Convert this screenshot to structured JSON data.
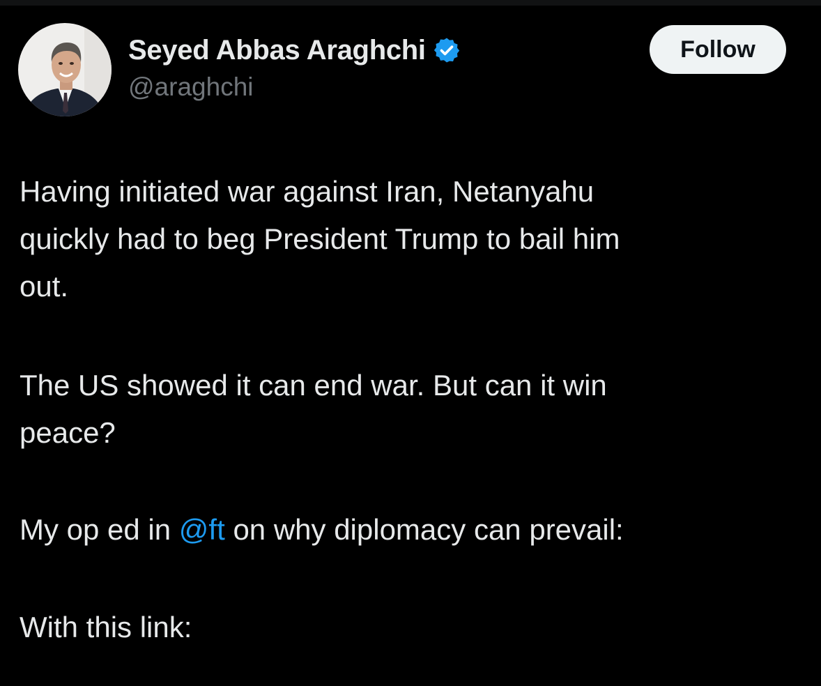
{
  "author": {
    "display_name": "Seyed Abbas Araghchi",
    "handle": "@araghchi",
    "verified_icon": "verified-badge-icon",
    "avatar_icon": "avatar-photo"
  },
  "follow_button": {
    "label": "Follow"
  },
  "tweet": {
    "paragraph1": {
      "line1": "Having initiated war against Iran, Netanyahu",
      "line2": "quickly had to beg President Trump to bail him",
      "line3": "out."
    },
    "paragraph2": {
      "line1": "The US showed it can end war. But can it win",
      "line2": "peace?"
    },
    "paragraph3": {
      "before": "My op ed in ",
      "mention": "@ft",
      "after": " on why diplomacy can prevail:"
    },
    "paragraph4": {
      "line1": "With this link:"
    }
  },
  "colors": {
    "background": "#000000",
    "text": "#e7e9ea",
    "secondary": "#71767b",
    "accent": "#1d9bf0",
    "button_bg": "#eff3f4"
  }
}
